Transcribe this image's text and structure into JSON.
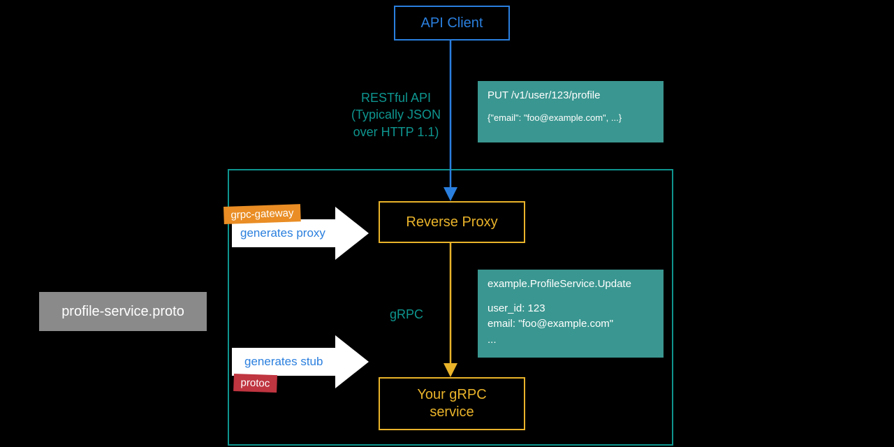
{
  "apiClient": {
    "label": "API Client"
  },
  "restLabel": {
    "line1": "RESTful API",
    "line2": "(Typically JSON",
    "line3": "over HTTP 1.1)"
  },
  "restPanel": {
    "request": "PUT /v1/user/123/profile",
    "body": "{\"email\": \"foo@example.com\", ...}"
  },
  "reverseProxy": {
    "label": "Reverse Proxy"
  },
  "grpcLabel": "gRPC",
  "grpcPanel": {
    "rpc": "example.ProfileService.Update",
    "l1": "user_id: 123",
    "l2": "email: \"foo@example.com\"",
    "l3": "..."
  },
  "grpcService": {
    "line1": "Your gRPC",
    "line2": "service"
  },
  "protoFile": "profile-service.proto",
  "arrowTop": {
    "tag": "grpc-gateway",
    "text": "generates proxy"
  },
  "arrowBottom": {
    "tag": "protoc",
    "text": "generates stub"
  },
  "colors": {
    "teal": "#0e958f",
    "apiBlue": "#2a7fde",
    "yellow": "#e9b32a"
  }
}
